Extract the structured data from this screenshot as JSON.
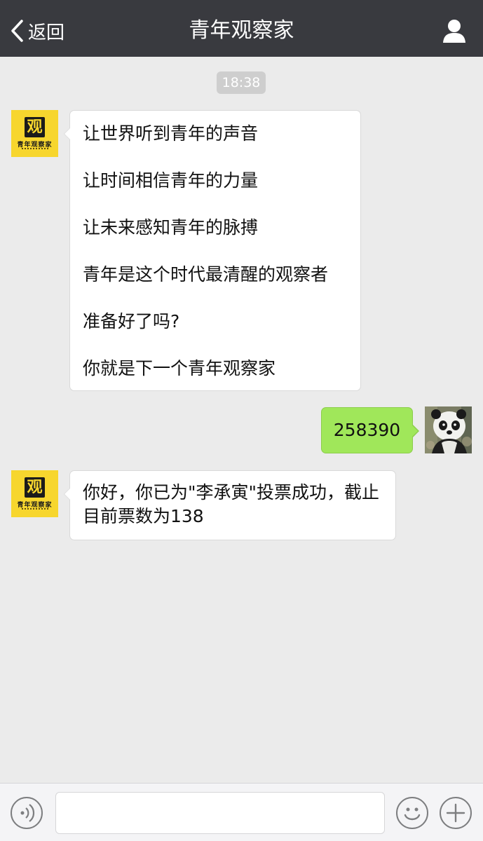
{
  "navbar": {
    "back_label": "返回",
    "title": "青年观察家"
  },
  "timestamp": "18:38",
  "official_avatar": {
    "logo_char": "观",
    "logo_text": "青年观察家"
  },
  "messages": {
    "incoming_1": {
      "lines": [
        "让世界听到青年的声音",
        "让时间相信青年的力量",
        "让未来感知青年的脉搏",
        "青年是这个时代最清醒的观察者",
        "准备好了吗?",
        "你就是下一个青年观察家"
      ]
    },
    "outgoing_1": {
      "text": "258390"
    },
    "incoming_2": {
      "text": "你好，你已为\"李承寅\"投票成功，截止目前票数为138"
    }
  },
  "inputbar": {
    "value": ""
  },
  "colors": {
    "navbar_bg": "#393a3f",
    "chat_bg": "#ebebeb",
    "outgoing_bubble": "#a0e75a",
    "incoming_bubble": "#ffffff",
    "logo_yellow": "#f7d62e"
  }
}
